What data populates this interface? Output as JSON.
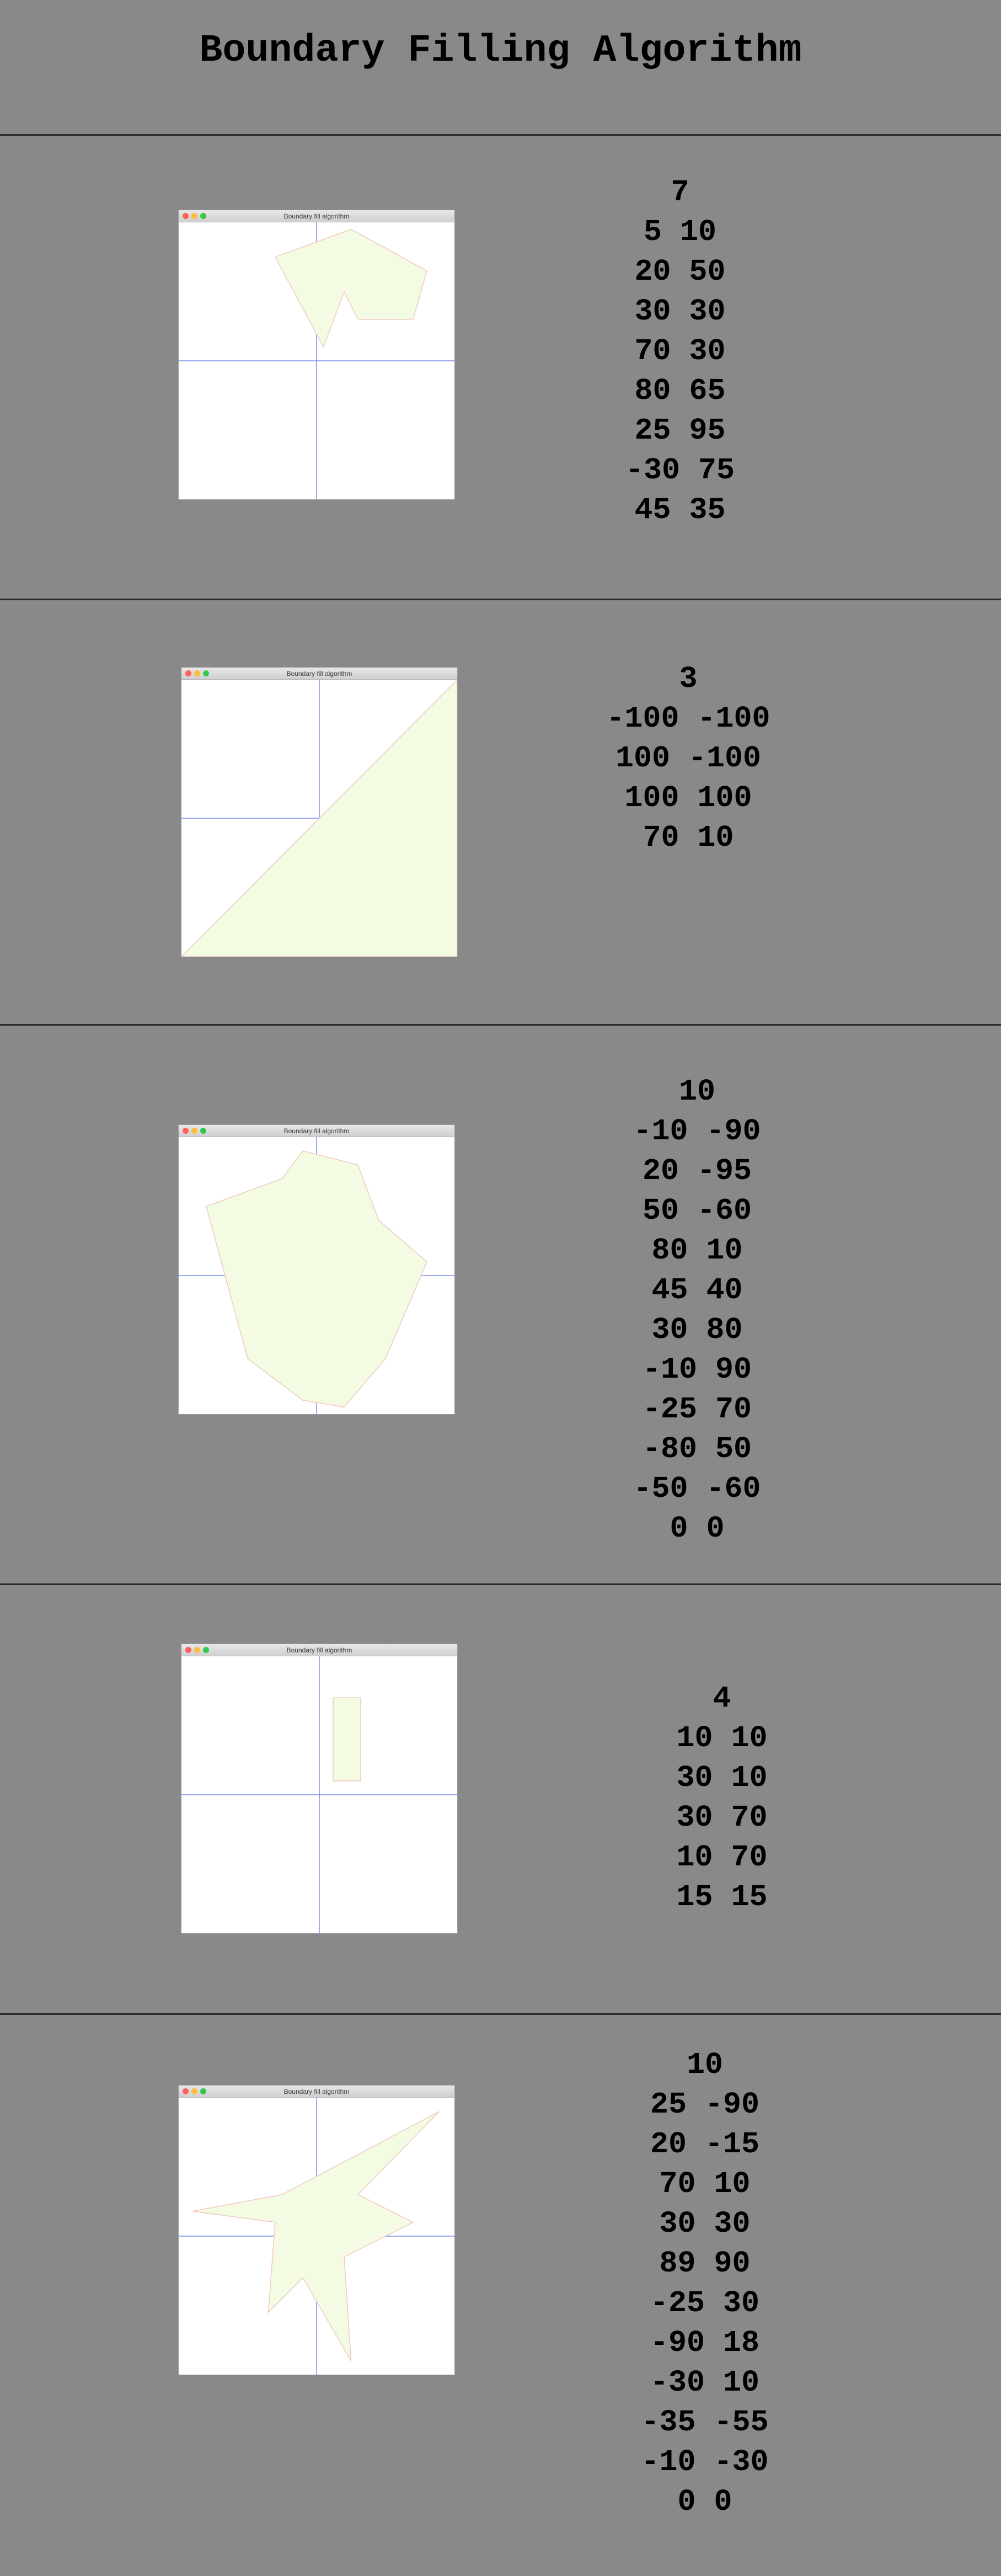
{
  "page_title": "Boundary Filling Algorithm",
  "window_title": "Boundary fill algorithm",
  "colors": {
    "background": "#898989",
    "fill": "#f3fce3",
    "edge": "#f2c7c2",
    "axis": "#5b78e6"
  },
  "examples": [
    {
      "count": "7",
      "points": [
        "5 10",
        "20 50",
        "30 30",
        "70 30",
        "80 65",
        "25 95",
        "-30 75"
      ],
      "seed": "45 35"
    },
    {
      "count": "3",
      "points": [
        "-100 -100",
        "100 -100",
        "100 100"
      ],
      "seed": "70 10"
    },
    {
      "count": "10",
      "points": [
        "-10 -90",
        "20 -95",
        "50 -60",
        "80 10",
        "45 40",
        "30 80",
        "-10 90",
        "-25 70",
        "-80 50",
        "-50 -60"
      ],
      "seed": "0 0"
    },
    {
      "count": "4",
      "points": [
        "10 10",
        "30 10",
        "30 70",
        "10 70"
      ],
      "seed": "15 15"
    },
    {
      "count": "10",
      "points": [
        "25 -90",
        "20 -15",
        "70 10",
        "30 30",
        "89 90",
        "-25 30",
        "-90 18",
        "-30 10",
        "-35 -55",
        "-10 -30"
      ],
      "seed": "0 0"
    }
  ]
}
